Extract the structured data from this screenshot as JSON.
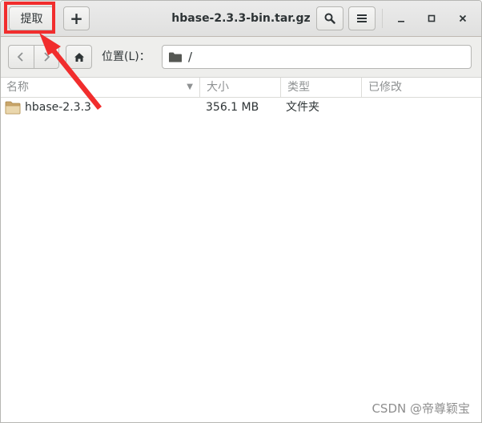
{
  "headerbar": {
    "extract_label": "提取",
    "add_label": "+",
    "title": "hbase-2.3.3-bin.tar.gz",
    "minimize_glyph": "—",
    "maximize_glyph": "□",
    "close_glyph": "✕"
  },
  "toolbar": {
    "location_label": "位置(L)：",
    "location_value": "/"
  },
  "columns": {
    "name": "名称",
    "size": "大小",
    "type": "类型",
    "modified": "已修改"
  },
  "rows": [
    {
      "name": "hbase-2.3.3",
      "size": "356.1 MB",
      "type": "文件夹",
      "modified": ""
    }
  ],
  "icons": {
    "back": "chevron-left-icon",
    "forward": "chevron-right-icon",
    "home": "home-icon",
    "folder": "folder-icon",
    "search": "search-icon",
    "menu": "hamburger-menu-icon"
  },
  "annotation": {
    "highlight_color": "#f12d2d"
  },
  "watermark": "CSDN @帝尊颖宝"
}
